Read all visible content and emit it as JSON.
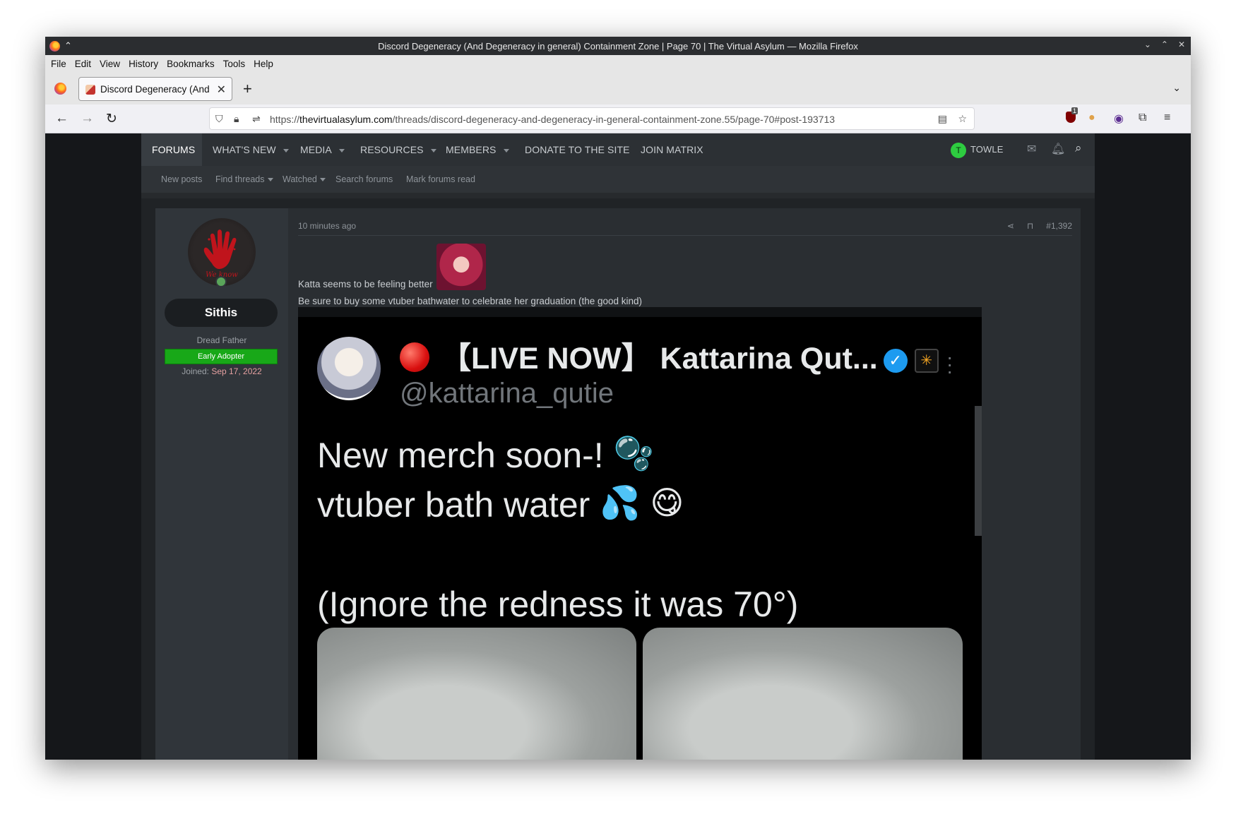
{
  "window": {
    "title": "Discord Degeneracy (And Degeneracy in general) Containment Zone | Page 70 | The Virtual Asylum — Mozilla Firefox"
  },
  "menu": [
    "File",
    "Edit",
    "View",
    "History",
    "Bookmarks",
    "Tools",
    "Help"
  ],
  "tab": {
    "title": "Discord Degeneracy (And De"
  },
  "url": {
    "scheme": "https://",
    "host": "thevirtualasylum.com",
    "path": "/threads/discord-degeneracy-and-degeneracy-in-general-containment-zone.55/page-70#post-193713"
  },
  "extensions": {
    "ublock_count": "1"
  },
  "forum_nav": {
    "items": [
      "FORUMS",
      "WHAT'S NEW",
      "MEDIA",
      "RESOURCES",
      "MEMBERS",
      "DONATE TO THE SITE",
      "JOIN MATRIX"
    ],
    "user_initial": "T",
    "username": "TOWLE"
  },
  "sub_nav": [
    "New posts",
    "Find threads",
    "Watched",
    "Search forums",
    "Mark forums read"
  ],
  "post": {
    "author": "Sithis",
    "avatar_text": "We know",
    "user_title": "Dread Father",
    "banner": "Early Adopter",
    "joined_label": "Joined:",
    "joined_date": "Sep 17, 2022",
    "time": "10 minutes ago",
    "number": "#1,392",
    "line1": "Katta seems to be feeling better",
    "line2": "Be sure to buy some vtuber bathwater to celebrate her graduation (the good kind)"
  },
  "tweet": {
    "name": "【LIVE NOW】 Kattarina Qut...",
    "handle": "@kattarina_qutie",
    "line1": "New merch soon-!",
    "line2": "vtuber bath water",
    "line3": "(Ignore the redness it was 70°)"
  }
}
